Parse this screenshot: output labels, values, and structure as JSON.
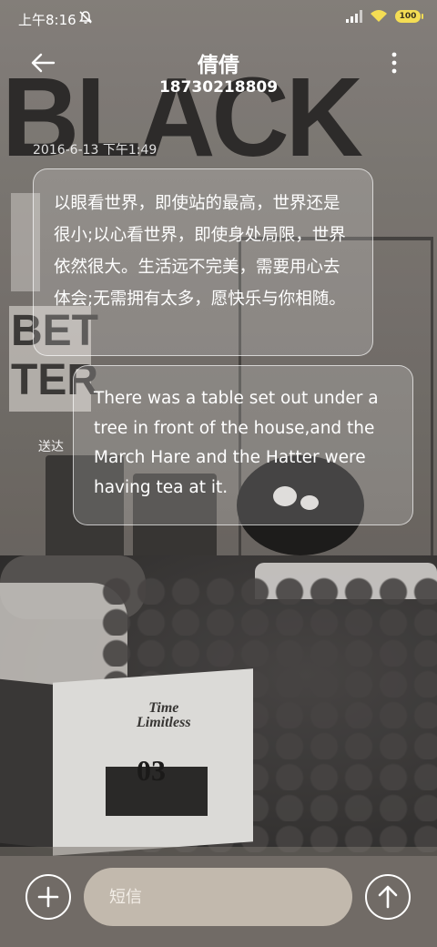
{
  "status_bar": {
    "time": "上午8:16",
    "battery": "100",
    "icons": [
      "bell-muted-icon",
      "signal-icon",
      "wifi-icon",
      "battery-icon"
    ]
  },
  "header": {
    "contact_name": "倩倩",
    "contact_number": "18730218809",
    "icons": [
      "back-arrow-icon",
      "more-vert-icon"
    ]
  },
  "conversation": {
    "timestamp": "2016-6-13 下午1:49",
    "messages": [
      {
        "text": "以眼看世界，即使站的最高，世界还是很小;以心看世界，即使身处局限，世界依然很大。生活远不完美，需要用心去体会;无需拥有太多，愿快乐与你相随。"
      },
      {
        "text": "There was a table set out under a tree in front of the house,and the March Hare and the Hatter were having tea at it.",
        "status": "送达"
      }
    ]
  },
  "composer": {
    "placeholder": "短信",
    "icons": [
      "plus-icon",
      "send-arrow-icon"
    ]
  },
  "colors": {
    "battery": "#f4dd54",
    "input_bg": "#c2b9ad",
    "bubble_border": "#ffffff"
  }
}
